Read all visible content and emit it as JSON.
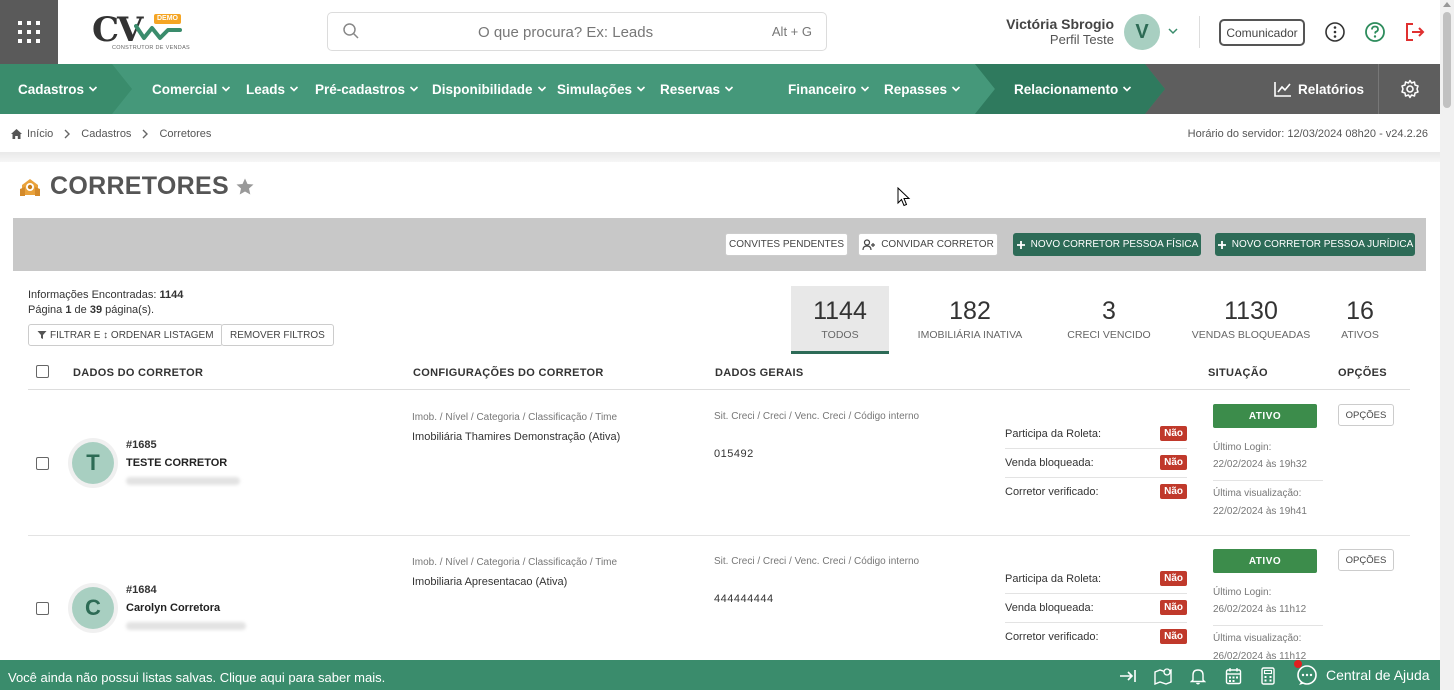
{
  "header": {
    "logo_text": "CV",
    "logo_badge": "DEMO",
    "logo_subtitle": "CONSTRUTOR DE VENDAS",
    "search_placeholder": "O que procura? Ex: Leads",
    "search_shortcut": "Alt + G",
    "user_name": "Victória Sbrogio",
    "user_profile": "Perfil Teste",
    "user_initial": "V",
    "communicator_label": "Comunicador"
  },
  "nav": {
    "items": [
      {
        "label": "Cadastros"
      },
      {
        "label": "Comercial"
      },
      {
        "label": "Leads"
      },
      {
        "label": "Pré-cadastros"
      },
      {
        "label": "Disponibilidade"
      },
      {
        "label": "Simulações"
      },
      {
        "label": "Reservas"
      },
      {
        "label": "Financeiro"
      },
      {
        "label": "Repasses"
      },
      {
        "label": "Relacionamento"
      }
    ],
    "reports_label": "Relatórios"
  },
  "breadcrumb": {
    "items": [
      "Início",
      "Cadastros",
      "Corretores"
    ],
    "server_time": "Horário do servidor: 12/03/2024 08h20 - v24.2.26"
  },
  "page": {
    "title": "CORRETORES"
  },
  "actions": {
    "pending_invites": "CONVITES PENDENTES",
    "invite_broker": "CONVIDAR CORRETOR",
    "new_pf": "NOVO CORRETOR PESSOA FÍSICA",
    "new_pj": "NOVO CORRETOR PESSOA JURÍDICA"
  },
  "info": {
    "found_label": "Informações Encontradas:",
    "found_count": "1144",
    "page_prefix": "Página",
    "page_current": "1",
    "page_middle": "de",
    "page_total": "39",
    "page_suffix": "página(s).",
    "filter_label": "FILTRAR E ↕ ORDENAR LISTAGEM",
    "remove_filters": "REMOVER FILTROS"
  },
  "stats": [
    {
      "value": "1144",
      "label": "TODOS"
    },
    {
      "value": "182",
      "label": "IMOBILIÁRIA INATIVA"
    },
    {
      "value": "3",
      "label": "CRECI VENCIDO"
    },
    {
      "value": "1130",
      "label": "VENDAS BLOQUEADAS"
    },
    {
      "value": "16",
      "label": "ATIVOS"
    }
  ],
  "table": {
    "headers": {
      "broker": "DADOS DO CORRETOR",
      "config": "CONFIGURAÇÕES DO CORRETOR",
      "general": "DADOS GERAIS",
      "status": "SITUAÇÃO",
      "options": "OPÇÕES"
    },
    "rows": [
      {
        "initial": "T",
        "id": "#1685",
        "name": "TESTE CORRETOR",
        "config_label": "Imob. / Nível / Categoria / Classificação / Time",
        "config_value": "Imobiliária Thamires Demonstração (Ativa)",
        "general_label": "Sit. Creci / Creci / Venc. Creci / Código interno",
        "general_value": "015492",
        "flags": [
          {
            "label": "Participa da Roleta:",
            "value": "Não"
          },
          {
            "label": "Venda bloqueada:",
            "value": "Não"
          },
          {
            "label": "Corretor verificado:",
            "value": "Não"
          }
        ],
        "status": "ATIVO",
        "last_login_label": "Último Login:",
        "last_login": "22/02/2024 às 19h32",
        "last_view_label": "Última visualização:",
        "last_view": "22/02/2024 às 19h41",
        "options_label": "OPÇÕES"
      },
      {
        "initial": "C",
        "id": "#1684",
        "name": "Carolyn Corretora",
        "config_label": "Imob. / Nível / Categoria / Classificação / Time",
        "config_value": "Imobiliaria Apresentacao (Ativa)",
        "general_label": "Sit. Creci / Creci / Venc. Creci / Código interno",
        "general_value": "444444444",
        "flags": [
          {
            "label": "Participa da Roleta:",
            "value": "Não"
          },
          {
            "label": "Venda bloqueada:",
            "value": "Não"
          },
          {
            "label": "Corretor verificado:",
            "value": "Não"
          }
        ],
        "status": "ATIVO",
        "last_login_label": "Último Login:",
        "last_login": "26/02/2024 às 11h12",
        "last_view_label": "Última visualização:",
        "last_view": "26/02/2024 às 11h12",
        "options_label": "OPÇÕES"
      }
    ]
  },
  "footer": {
    "message": "Você ainda não possui listas salvas. Clique aqui para saber mais.",
    "help_label": "Central de Ajuda"
  },
  "colors": {
    "brand_green": "#3a8c6c",
    "dark_green": "#2d6b57",
    "active_status": "#3c8c4b",
    "badge_red": "#c0392b",
    "logout_red": "#e03030"
  }
}
